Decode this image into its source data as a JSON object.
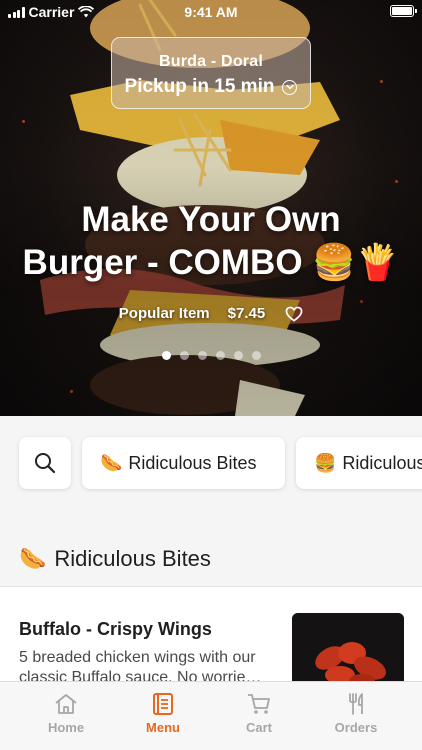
{
  "status_bar": {
    "carrier": "Carrier",
    "time": "9:41 AM"
  },
  "location": {
    "name": "Burda - Doral",
    "pickup": "Pickup in 15 min"
  },
  "hero": {
    "title_line1": "Make Your Own",
    "title_line2": "Burger - COMBO 🍔🍟",
    "badge": "Popular Item",
    "price": "$7.45",
    "slide_count": 6,
    "active_slide": 1
  },
  "categories": [
    {
      "emoji": "🌭",
      "label": "Ridiculous Bites"
    },
    {
      "emoji": "🍔",
      "label": "Ridiculous Burgers"
    }
  ],
  "section": {
    "emoji": "🌭",
    "title": "Ridiculous Bites"
  },
  "item": {
    "name": "Buffalo - Crispy Wings",
    "description": "5 breaded chicken wings with our classic Buffalo sauce.  No worrie…"
  },
  "tabs": [
    {
      "label": "Home",
      "icon": "home-icon"
    },
    {
      "label": "Menu",
      "icon": "menu-book-icon",
      "active": true
    },
    {
      "label": "Cart",
      "icon": "cart-icon"
    },
    {
      "label": "Orders",
      "icon": "fork-knife-icon"
    }
  ],
  "colors": {
    "accent": "#e8681e",
    "inactive": "#a7a7a7",
    "text": "#1f1f1f"
  }
}
